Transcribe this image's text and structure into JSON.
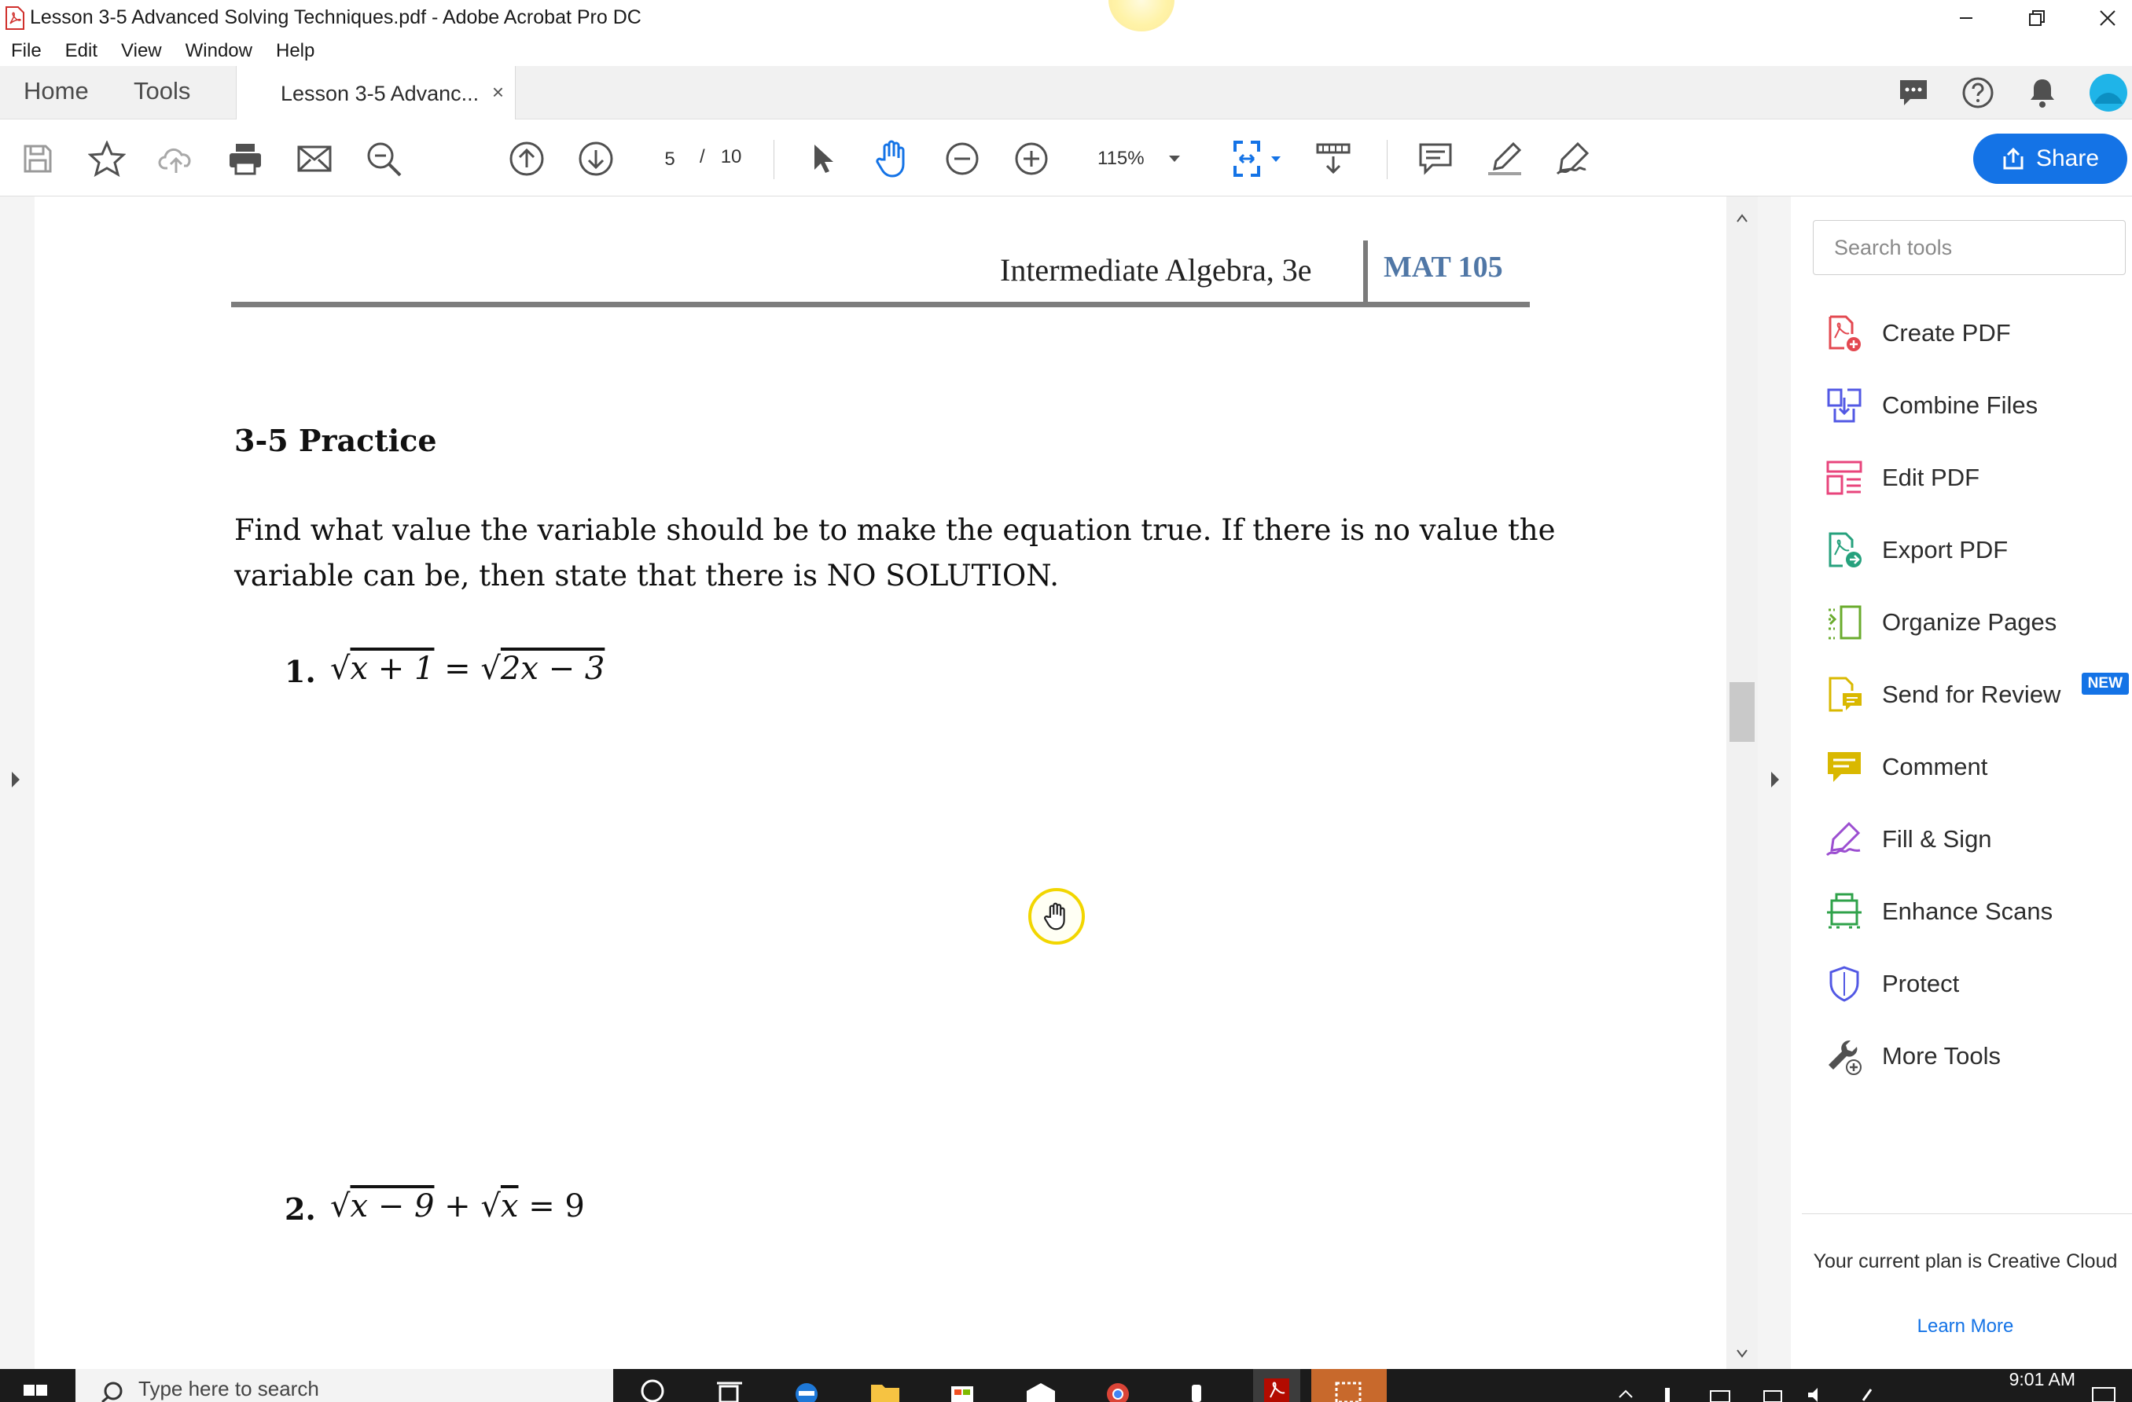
{
  "window": {
    "title": "Lesson 3-5 Advanced Solving Techniques.pdf - Adobe Acrobat Pro DC"
  },
  "menu": [
    "File",
    "Edit",
    "View",
    "Window",
    "Help"
  ],
  "tabs": {
    "home": "Home",
    "tools": "Tools",
    "document": "Lesson 3-5 Advanc...",
    "close": "×"
  },
  "toolbar": {
    "current_page": "5",
    "page_separator": "/",
    "total_pages": "10",
    "zoom": "115%",
    "share_label": "Share"
  },
  "document": {
    "header_title": "Intermediate Algebra, 3e",
    "header_course": "MAT 105",
    "section_heading": "3-5 Practice",
    "instructions": "Find what value the variable should be to make the equation true. If there is no value the variable can be, then state that there is NO SOLUTION.",
    "problems": [
      {
        "number": "1.",
        "lhs_radicand": "x + 1",
        "op": "=",
        "rhs_radicand": "2x − 3",
        "rhs_tail": ""
      },
      {
        "number": "2.",
        "lhs_radicand": "x − 9",
        "op": "+",
        "rhs_radicand": "x",
        "rhs_tail": "= 9"
      }
    ]
  },
  "tools_panel": {
    "search_placeholder": "Search tools",
    "items": [
      {
        "label": "Create PDF",
        "color": "#e34850"
      },
      {
        "label": "Combine Files",
        "color": "#5258e4"
      },
      {
        "label": "Edit PDF",
        "color": "#e8457c"
      },
      {
        "label": "Export PDF",
        "color": "#26a17d"
      },
      {
        "label": "Organize Pages",
        "color": "#6aab2d"
      },
      {
        "label": "Send for Review",
        "color": "#d9b800",
        "badge": "NEW"
      },
      {
        "label": "Comment",
        "color": "#d9b800"
      },
      {
        "label": "Fill & Sign",
        "color": "#9c4fd1"
      },
      {
        "label": "Enhance Scans",
        "color": "#2fa24a"
      },
      {
        "label": "Protect",
        "color": "#5258e4"
      },
      {
        "label": "More Tools",
        "color": "#505050"
      }
    ],
    "plan_text": "Your current plan is Creative Cloud",
    "learn_more": "Learn More"
  },
  "taskbar": {
    "search_text": "Type here to search",
    "time": "9:01 AM"
  },
  "colors": {
    "accent": "#1473e6",
    "course_blue": "#5077a6"
  }
}
